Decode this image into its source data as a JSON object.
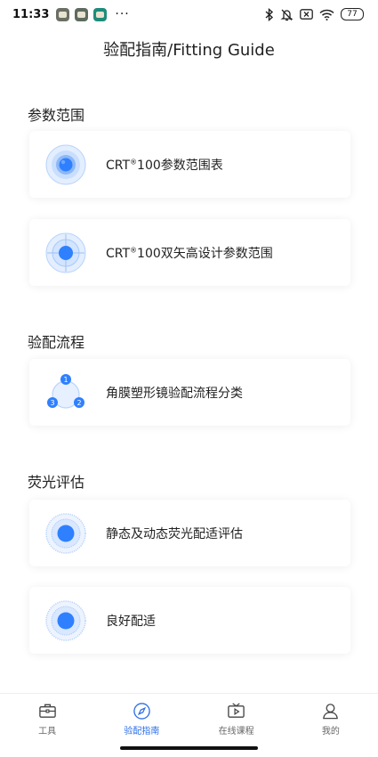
{
  "status_bar": {
    "time": "11:33",
    "more": "···",
    "battery": "77"
  },
  "header": {
    "title": "验配指南/Fitting Guide"
  },
  "sections": [
    {
      "title": "参数范围",
      "items": [
        {
          "label_prefix": "CRT",
          "label_sup": "®",
          "label_rest": "100参数范围表",
          "icon": "concentric-circles-icon"
        },
        {
          "label_prefix": "CRT",
          "label_sup": "®",
          "label_rest": "100双矢高设计参数范围",
          "icon": "crosshair-target-icon"
        }
      ]
    },
    {
      "title": "验配流程",
      "items": [
        {
          "label": "角膜塑形镜验配流程分类",
          "icon": "process-cycle-icon",
          "steps": [
            "1",
            "2",
            "3"
          ]
        }
      ]
    },
    {
      "title": "荧光评估",
      "items": [
        {
          "label": "静态及动态荧光配适评估",
          "icon": "fluorescein-pattern-icon"
        },
        {
          "label": "良好配适",
          "icon": "fluorescein-pattern-icon"
        }
      ]
    }
  ],
  "tabs": [
    {
      "label": "工具",
      "icon": "toolbox-icon",
      "active": false
    },
    {
      "label": "验配指南",
      "icon": "compass-icon",
      "active": true
    },
    {
      "label": "在线课程",
      "icon": "tv-play-icon",
      "active": false
    },
    {
      "label": "我的",
      "icon": "user-icon",
      "active": false
    }
  ],
  "colors": {
    "accent": "#2c6fe8",
    "icon_blue": "#2f80ff",
    "icon_light": "#d6e7ff"
  }
}
